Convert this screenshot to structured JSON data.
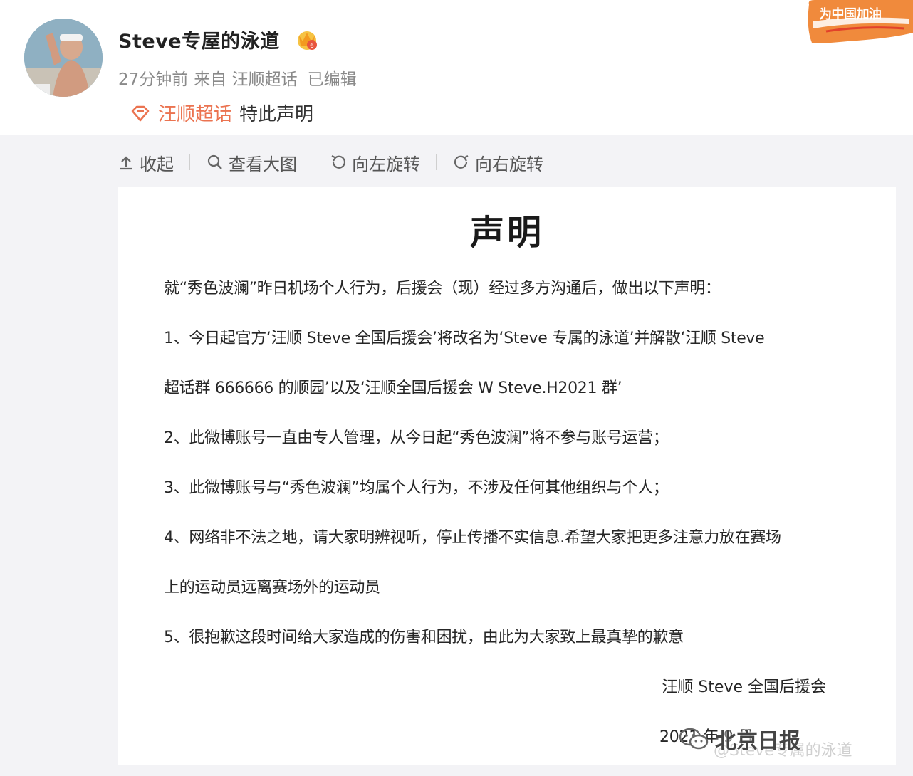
{
  "post": {
    "username": "Steve专屋的泳道",
    "time": "27分钟前",
    "from": "来自 汪顺超话",
    "edited": "已编辑",
    "topic": "汪顺超话",
    "text": "特此声明"
  },
  "badge": {
    "text": "为中国加油"
  },
  "toolbar": {
    "collapse": "收起",
    "view_large": "查看大图",
    "rotate_left": "向左旋转",
    "rotate_right": "向右旋转"
  },
  "document": {
    "title": "声明",
    "intro": "就“秀色波澜”昨日机场个人行为，后援会（现）经过多方沟通后，做出以下声明：",
    "p1a": "1、今日起官方‘汪顺 Steve 全国后援会’将改名为‘Steve 专属的泳道’并解散‘汪顺 Steve",
    "p1b": "超话群 666666 的顺园’以及‘汪顺全国后援会 W Steve.H2021 群’",
    "p2": "2、此微博账号一直由专人管理，从今日起“秀色波澜”将不参与账号运营；",
    "p3": "3、此微博账号与“秀色波澜”均属个人行为，不涉及任何其他组织与个人；",
    "p4a": "4、网络非不法之地，请大家明辨视听，停止传播不实信息.希望大家把更多注意力放在赛场",
    "p4b": "上的运动员远离赛场外的运动员",
    "p5": "5、很抱歉这段时间给大家造成的伤害和困扰，由此为大家致上最真挚的歉意",
    "signature": "汪顺 Steve 全国后援会",
    "date": "2021 年 9 月"
  },
  "watermark": {
    "text": "北京日报",
    "faint": "@Steve专属的泳道"
  },
  "colors": {
    "accent": "#eb7350",
    "background": "#f3f3f6"
  }
}
